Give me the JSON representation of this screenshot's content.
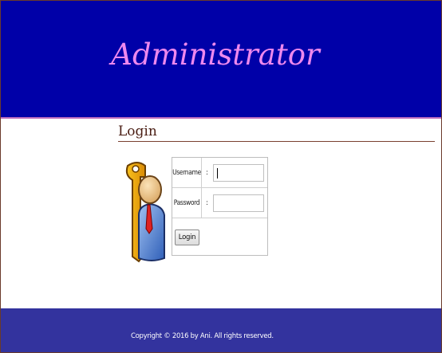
{
  "header": {
    "title": "Administrator"
  },
  "section": {
    "title": "Login"
  },
  "form": {
    "username_label": "Username",
    "username_sep": ":",
    "username_value": "",
    "password_label": "Password",
    "password_sep": ":",
    "password_value": "",
    "login_label": "Login"
  },
  "footer": {
    "copyright": "Copyright © 2016 by Ani. All rights reserved."
  },
  "colors": {
    "header_bg": "#0000a8",
    "title": "#ee88ee",
    "footer_bg": "#33339e",
    "section_text": "#4a1e14"
  },
  "icons": {
    "login_illustration": "key-user-icon"
  }
}
